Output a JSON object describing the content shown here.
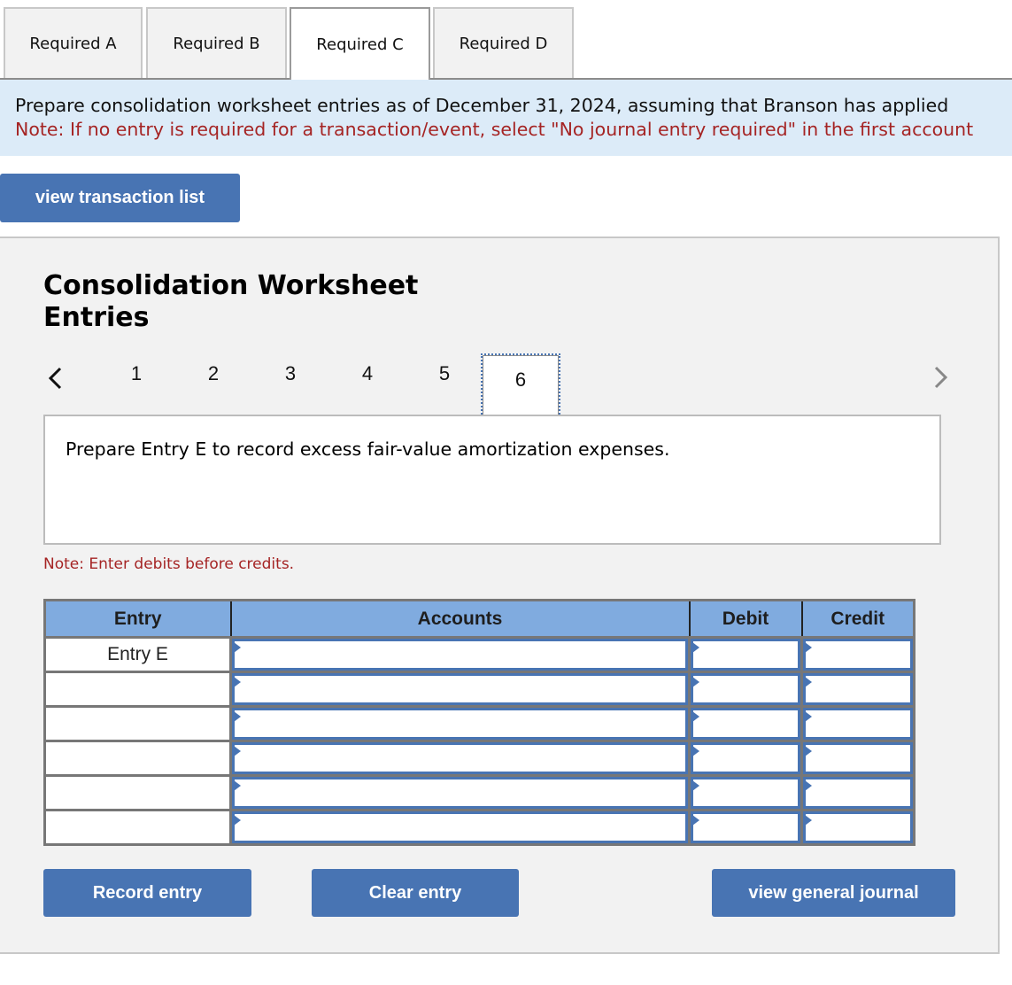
{
  "tabs": [
    {
      "label": "Required A",
      "active": false
    },
    {
      "label": "Required B",
      "active": false
    },
    {
      "label": "Required C",
      "active": true
    },
    {
      "label": "Required D",
      "active": false
    }
  ],
  "instructions": {
    "line1": "Prepare consolidation worksheet entries as of December 31, 2024, assuming that Branson has applied",
    "line2": "Note: If no entry is required for a transaction/event, select \"No journal entry required\" in the first account"
  },
  "buttons": {
    "view_transaction_list": "view transaction list",
    "record_entry": "Record entry",
    "clear_entry": "Clear entry",
    "view_general_journal": "view general journal"
  },
  "panel": {
    "title_line1": "Consolidation Worksheet",
    "title_line2": "Entries",
    "pager": {
      "pages": [
        "1",
        "2",
        "3",
        "4",
        "5",
        "6"
      ],
      "current": "6"
    },
    "question": "Prepare Entry E to record excess fair-value amortization expenses.",
    "note": "Note: Enter debits before credits."
  },
  "table": {
    "headers": {
      "entry": "Entry",
      "accounts": "Accounts",
      "debit": "Debit",
      "credit": "Credit"
    },
    "rows": [
      {
        "entry": "Entry E",
        "account": "",
        "debit": "",
        "credit": ""
      },
      {
        "entry": "",
        "account": "",
        "debit": "",
        "credit": ""
      },
      {
        "entry": "",
        "account": "",
        "debit": "",
        "credit": ""
      },
      {
        "entry": "",
        "account": "",
        "debit": "",
        "credit": ""
      },
      {
        "entry": "",
        "account": "",
        "debit": "",
        "credit": ""
      },
      {
        "entry": "",
        "account": "",
        "debit": "",
        "credit": ""
      }
    ]
  },
  "colors": {
    "accent": "#4874b3",
    "header": "#80abdf",
    "note": "#a52424",
    "band": "#dcebf8"
  }
}
